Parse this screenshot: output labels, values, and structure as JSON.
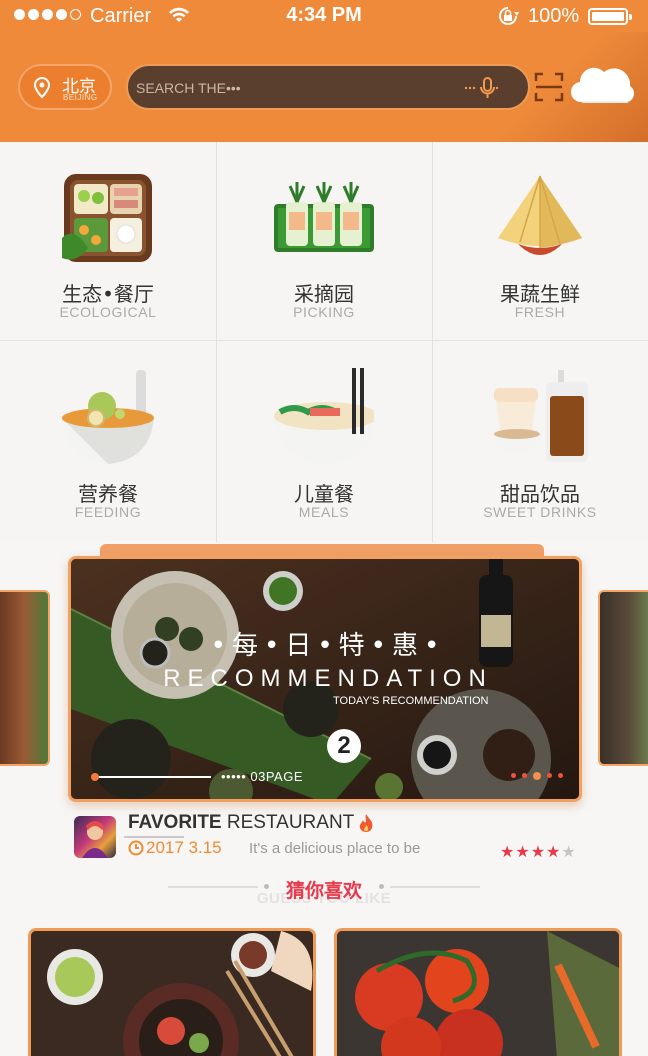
{
  "status_bar": {
    "carrier": "Carrier",
    "time": "4:34 PM",
    "battery": "100%"
  },
  "header": {
    "city_cn": "北京",
    "city_en": "BEIJING",
    "search_placeholder": "SEARCH THE•••"
  },
  "categories": [
    {
      "cn": "生态•餐厅",
      "en": "ECOLOGICAL",
      "icon": "bento-box-icon"
    },
    {
      "cn": "采摘园",
      "en": "PICKING",
      "icon": "vegetable-planter-icon"
    },
    {
      "cn": "果蔬生鲜",
      "en": "FRESH",
      "icon": "straw-hat-icon"
    },
    {
      "cn": "营养餐",
      "en": "FEEDING",
      "icon": "soup-bowl-icon"
    },
    {
      "cn": "儿童餐",
      "en": "MEALS",
      "icon": "noodle-bowl-icon"
    },
    {
      "cn": "甜品饮品",
      "en": "SWEET DRINKS",
      "icon": "drinks-icon"
    }
  ],
  "banner": {
    "title_cn": "•每•日•特•惠•",
    "title_en": "RECOMMENDATION",
    "subtitle": "TODAY'S RECOMMENDATION",
    "number": "2",
    "page": "••••• 03PAGE"
  },
  "restaurant": {
    "name_bold": "FAVORITE",
    "name_rest": " RESTAURANT",
    "date": "2017  3.15",
    "description": "It's a delicious place to be",
    "rating": 4,
    "rating_max": 5
  },
  "guess": {
    "cn": "猜你喜欢",
    "en": "GUESS YOU LIKE"
  },
  "colors": {
    "brand_orange": "#ee8a3a",
    "accent_red": "#e8384a",
    "date_orange": "#f08a30"
  }
}
